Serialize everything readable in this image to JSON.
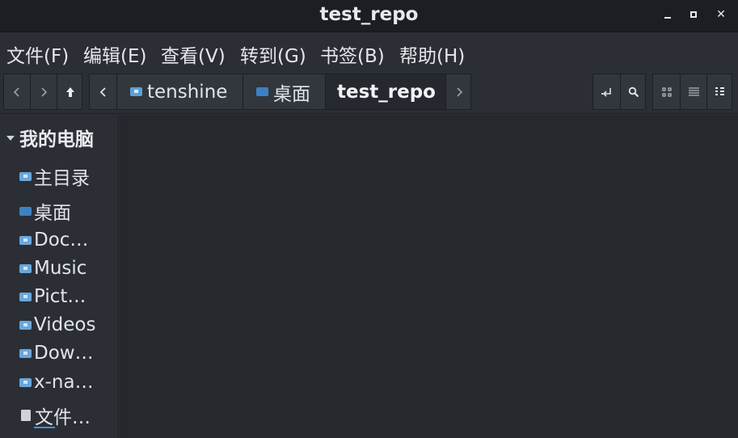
{
  "window": {
    "title": "test_repo"
  },
  "menubar": {
    "items": [
      "文件(F)",
      "编辑(E)",
      "查看(V)",
      "转到(G)",
      "书签(B)",
      "帮助(H)"
    ]
  },
  "toolbar": {
    "breadcrumbs": [
      {
        "label": "tenshine",
        "icon": "home-folder-icon"
      },
      {
        "label": "桌面",
        "icon": "desktop-folder-icon"
      },
      {
        "label": "test_repo",
        "active": true
      }
    ]
  },
  "sidebar": {
    "header": "我的电脑",
    "items": [
      {
        "label": "主目录",
        "icon": "home-folder-icon"
      },
      {
        "label": "桌面",
        "icon": "desktop-folder-icon"
      },
      {
        "label": "Doc…",
        "icon": "documents-folder-icon"
      },
      {
        "label": "Music",
        "icon": "music-folder-icon"
      },
      {
        "label": "Pict…",
        "icon": "pictures-folder-icon"
      },
      {
        "label": "Videos",
        "icon": "videos-folder-icon"
      },
      {
        "label": "Dow…",
        "icon": "downloads-folder-icon"
      },
      {
        "label": "x-na…",
        "icon": "network-folder-icon"
      },
      {
        "label": "文件…",
        "icon": "filesystem-drive-icon"
      }
    ]
  },
  "colors": {
    "titlebar": "#1c1e23",
    "background": "#2b2e35",
    "content": "#25282d",
    "accent": "#4a90d9"
  }
}
